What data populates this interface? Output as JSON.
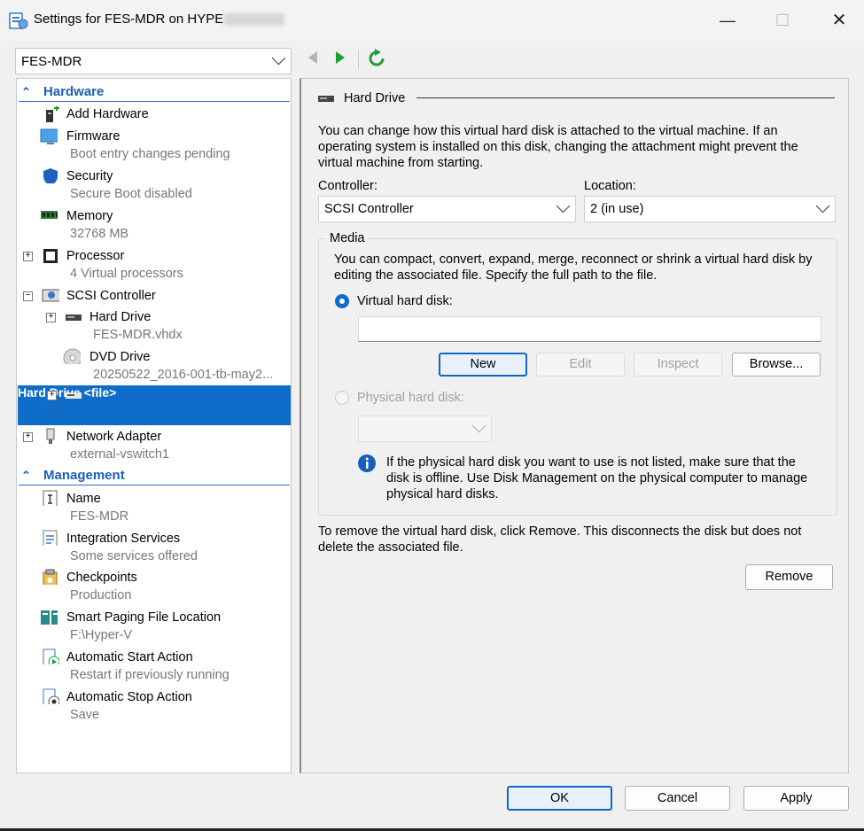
{
  "window": {
    "title_prefix": "Settings for FES-MDR on HYPE",
    "minimize": "—",
    "maximize": "☐",
    "close": "✕"
  },
  "vm_selector": {
    "value": "FES-MDR"
  },
  "tree": {
    "hardware_header": "Hardware",
    "management_header": "Management",
    "items": {
      "add_hardware": {
        "label": "Add Hardware"
      },
      "firmware": {
        "label": "Firmware",
        "sub": "Boot entry changes pending"
      },
      "security": {
        "label": "Security",
        "sub": "Secure Boot disabled"
      },
      "memory": {
        "label": "Memory",
        "sub": "32768 MB"
      },
      "processor": {
        "label": "Processor",
        "sub": "4 Virtual processors"
      },
      "scsi": {
        "label": "SCSI Controller"
      },
      "hard_drive_1": {
        "label": "Hard Drive",
        "sub": "FES-MDR.vhdx"
      },
      "dvd_drive": {
        "label": "DVD Drive",
        "sub": "20250522_2016-001-tb-may2..."
      },
      "hard_drive_2": {
        "label": "Hard Drive",
        "sub": "<file>"
      },
      "network_adapter": {
        "label": "Network Adapter",
        "sub": "external-vswitch1"
      },
      "name": {
        "label": "Name",
        "sub": "FES-MDR"
      },
      "integration": {
        "label": "Integration Services",
        "sub": "Some services offered"
      },
      "checkpoints": {
        "label": "Checkpoints",
        "sub": "Production"
      },
      "smart_paging": {
        "label": "Smart Paging File Location",
        "sub": "F:\\Hyper-V"
      },
      "auto_start": {
        "label": "Automatic Start Action",
        "sub": "Restart if previously running"
      },
      "auto_stop": {
        "label": "Automatic Stop Action",
        "sub": "Save"
      }
    }
  },
  "panel": {
    "heading": "Hard Drive",
    "intro": "You can change how this virtual hard disk is attached to the virtual machine. If an operating system is installed on this disk, changing the attachment might prevent the virtual machine from starting.",
    "controller_label": "Controller:",
    "controller_value": "SCSI Controller",
    "location_label": "Location:",
    "location_value": "2 (in use)",
    "media_label": "Media",
    "media_text": "You can compact, convert, expand, merge, reconnect or shrink a virtual hard disk by editing the associated file. Specify the full path to the file.",
    "vhd_label": "Virtual hard disk:",
    "vhd_path": "",
    "new_btn": "New",
    "edit_btn": "Edit",
    "inspect_btn": "Inspect",
    "browse_btn": "Browse...",
    "physical_label": "Physical hard disk:",
    "info_text": "If the physical hard disk you want to use is not listed, make sure that the disk is offline. Use Disk Management on the physical computer to manage physical hard disks.",
    "remove_text": "To remove the virtual hard disk, click Remove. This disconnects the disk but does not delete the associated file.",
    "remove_btn": "Remove"
  },
  "footer": {
    "ok": "OK",
    "cancel": "Cancel",
    "apply": "Apply"
  },
  "colors": {
    "accent": "#0f6cc9",
    "section": "#1c5fb5",
    "refresh": "#1f9d3a"
  }
}
